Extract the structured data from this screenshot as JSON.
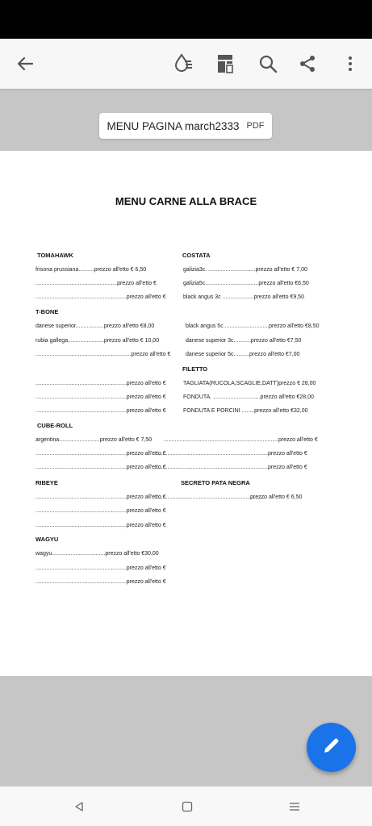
{
  "document": {
    "filename": "MENU PAGINA march2333",
    "type_label": "PDF",
    "heading": "MENU CARNE ALLA BRACE"
  },
  "appbar": {
    "icons": [
      "back-arrow-icon",
      "reading-mode-icon",
      "document-layout-icon",
      "search-icon",
      "share-icon",
      "more-vert-icon"
    ]
  },
  "menu": {
    "tomahawk": {
      "title": "TOMAHAWK",
      "lines": [
        "frisona prussiana..........prezzo all'etto € 6,50",
        "....................................................prezzo all'etto €",
        "..........................................................prezzo all'etto €"
      ]
    },
    "costata": {
      "title": "COSTATA",
      "lines": [
        "galizia3c. ..............................prezzo all'etto € 7,00",
        "galizia5c..................................prezzo all'etto €6,50",
        "black angus 3c ....................prezzo all'etto €9,50"
      ]
    },
    "tbone": {
      "title": "T-BONE",
      "lines": [
        "danese superior..................prezzo all'etto €8,00",
        "rubia gallega.......................prezzo all'etto € 10,00",
        ".............................................................prezzo all'etto €"
      ]
    },
    "tbone_right": {
      "lines": [
        "black angus 5c ............................prezzo all'etto €8,50",
        "danese superior 3c...........prezzo all'etto €7,50",
        "danese superior 5c..........prezzo all'etto €7,00"
      ]
    },
    "filetto": {
      "title": "FILETTO",
      "lines": [
        "TAGLIATA(RUCOLA,SCAGLIE,DATT)prezzo  €  28,00",
        "FONDUTA. ..............................prezzo all'etto €28,00",
        "FONDUTA E PORCINI ........prezzo all'etto €32,00"
      ]
    },
    "filetto_left": {
      "lines": [
        "..........................................................prezzo all'etto €",
        "..........................................................prezzo all'etto €",
        "..........................................................prezzo all'etto €"
      ]
    },
    "cuberoll": {
      "title": "CUBE-ROLL",
      "lines": [
        "argentina..........................prezzo all'etto € 7,50",
        "..........................................................prezzo all'etto €",
        "..........................................................prezzo all'etto €"
      ],
      "right_lines": [
        ".........................................................................prezzo all'etto €",
        ".........................................................................prezzo all'etto €",
        ".........................................................................prezzo all'etto €"
      ]
    },
    "ribeye": {
      "title": "RIBEYE",
      "lines": [
        "..........................................................prezzo all'etto  €",
        "..........................................................prezzo all'etto €",
        "..........................................................prezzo all'etto €"
      ],
      "right_first": "......................................................................."
    },
    "secreto": {
      "title": "SECRETO PATA NEGRA",
      "lines": [
        "prezzo all'etto € 6,50"
      ]
    },
    "wagyu": {
      "title": "WAGYU",
      "lines": [
        "wagyu..................................prezzo all'etto €30,00",
        "..........................................................prezzo all'etto €",
        "..........................................................prezzo all'etto €"
      ]
    }
  },
  "fab": {
    "icon": "edit-pencil-icon"
  },
  "navbar": {
    "icons": [
      "back-triangle-icon",
      "home-square-icon",
      "recents-menu-icon"
    ]
  }
}
